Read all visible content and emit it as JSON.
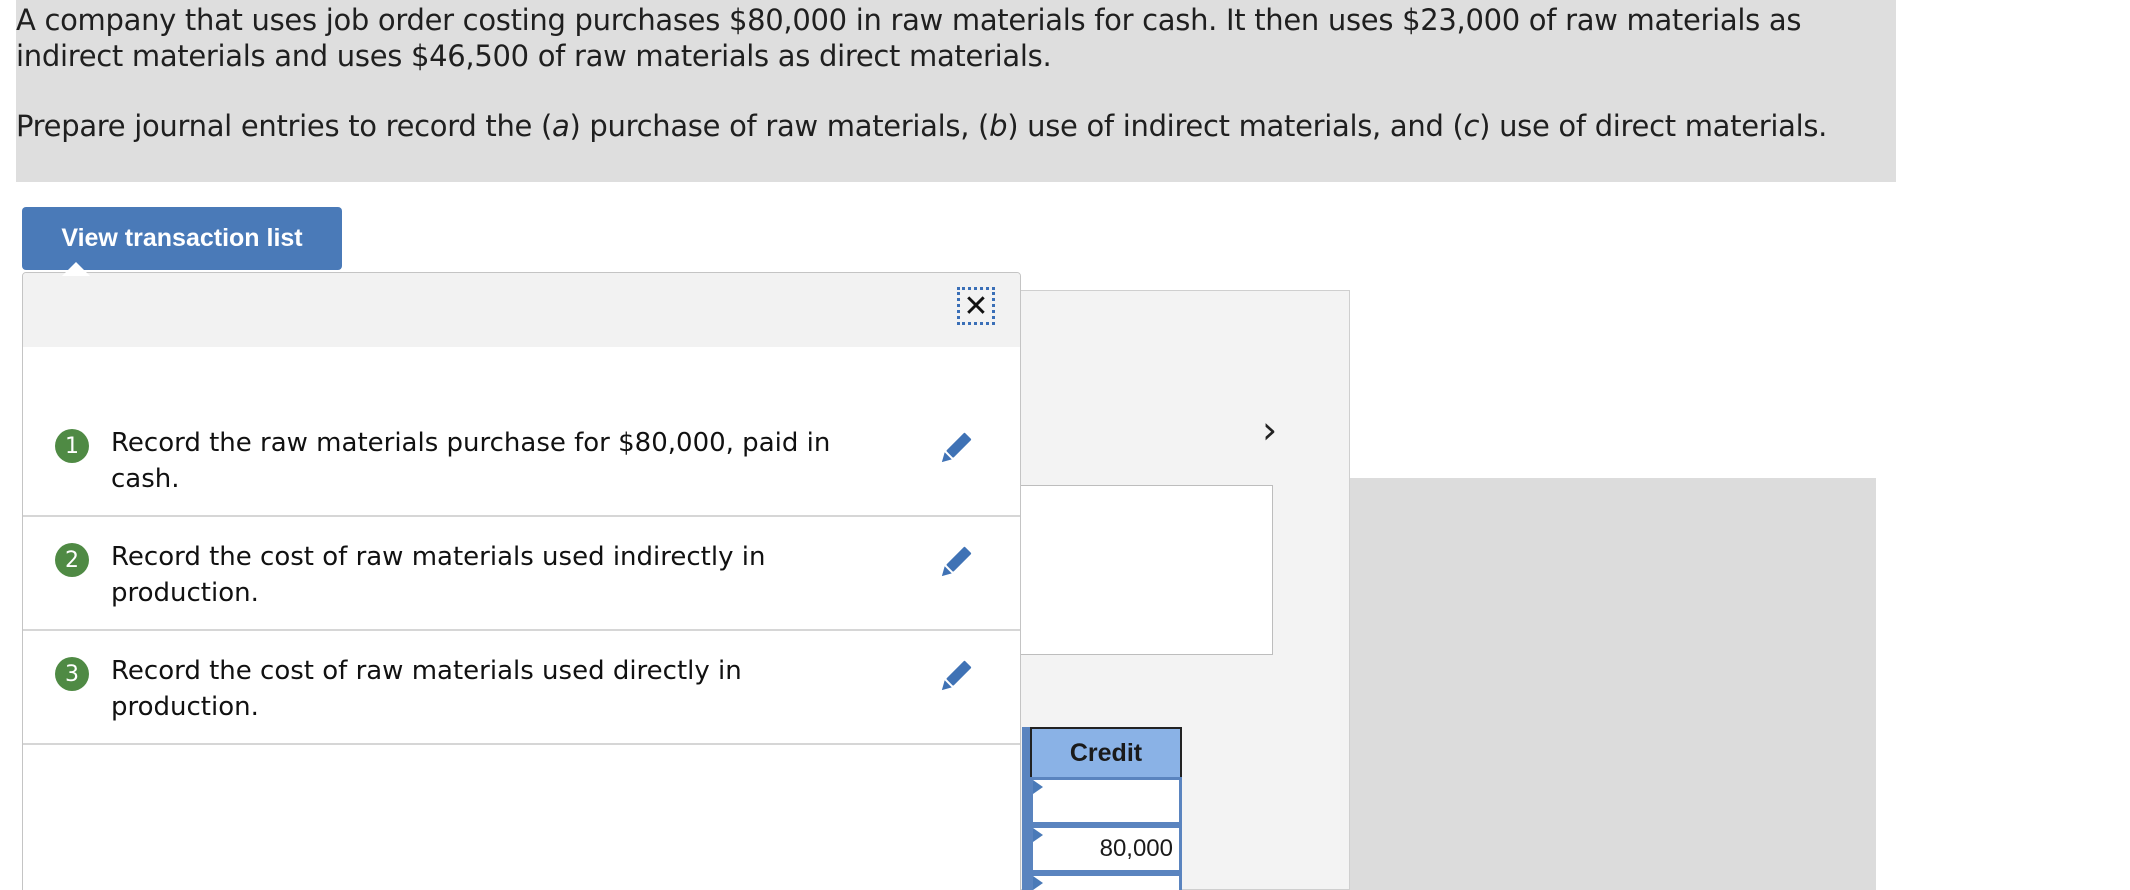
{
  "problem": {
    "paragraph1": "A company that uses job order costing purchases $80,000 in raw materials for cash. It then uses $23,000 of raw materials as indirect materials and uses $46,500 of raw materials as direct materials.",
    "paragraph2_parts": {
      "before_a": "Prepare journal entries to record the (",
      "a": "a",
      "after_a": ") purchase of raw materials, (",
      "b": "b",
      "after_b": ") use of indirect materials, and (",
      "c": "c",
      "after_c": ") use of direct materials."
    }
  },
  "view_transaction_button": "View transaction list",
  "popup": {
    "close_glyph": "✕",
    "transactions": [
      {
        "number": "1",
        "text": "Record the raw materials purchase for $80,000, paid in cash."
      },
      {
        "number": "2",
        "text": "Record the cost of raw materials used indirectly in production."
      },
      {
        "number": "3",
        "text": "Record the cost of raw materials used directly in production."
      }
    ]
  },
  "journal": {
    "next_glyph": "›",
    "credit_header": "Credit",
    "credit_values": [
      "",
      "80,000",
      ""
    ]
  },
  "colors": {
    "accent_blue": "#4a7ab8",
    "number_badge_green": "#4f8a44",
    "credit_header_blue": "#8ab2e6"
  }
}
